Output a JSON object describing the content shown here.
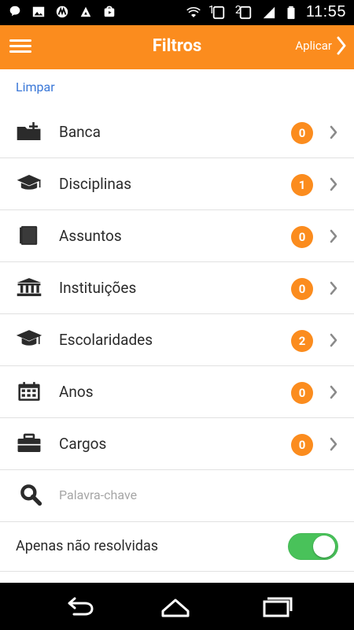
{
  "status_bar": {
    "time": "11:55",
    "left_icons": [
      "chat-bubble-icon",
      "image-icon",
      "motorola-icon",
      "tool-icon",
      "store-icon"
    ],
    "right_icons": [
      "wifi-icon",
      "sim1-icon",
      "sim2-icon",
      "signal-icon",
      "battery-icon"
    ],
    "sim1_label": "1",
    "sim2_label": "2"
  },
  "app_bar": {
    "title": "Filtros",
    "apply_label": "Aplicar"
  },
  "clear_label": "Limpar",
  "filters": [
    {
      "label": "Banca",
      "count": "0",
      "icon": "folder-add-icon"
    },
    {
      "label": "Disciplinas",
      "count": "1",
      "icon": "graduation-cap-icon"
    },
    {
      "label": "Assuntos",
      "count": "0",
      "icon": "book-icon"
    },
    {
      "label": "Instituições",
      "count": "0",
      "icon": "institution-icon"
    },
    {
      "label": "Escolaridades",
      "count": "2",
      "icon": "mortarboard-icon"
    },
    {
      "label": "Anos",
      "count": "0",
      "icon": "calendar-icon"
    },
    {
      "label": "Cargos",
      "count": "0",
      "icon": "briefcase-icon"
    }
  ],
  "keyword": {
    "placeholder": "Palavra-chave",
    "icon": "search-icon"
  },
  "toggle": {
    "label": "Apenas não resolvidas",
    "on": true
  },
  "colors": {
    "accent": "#fb8c1e",
    "link": "#3b78d8",
    "toggle_on": "#49c25a"
  }
}
